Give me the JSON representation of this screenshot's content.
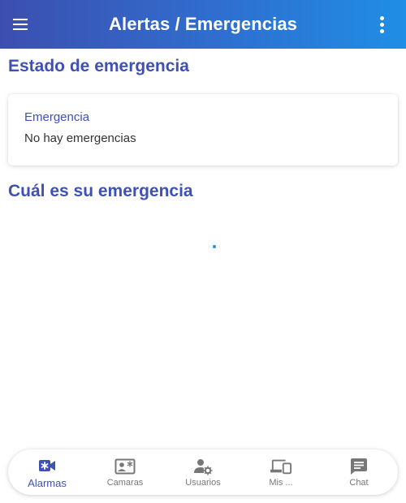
{
  "app_bar": {
    "title": "Alertas / Emergencias",
    "menu_icon": "menu-icon",
    "more_icon": "more-vert-icon"
  },
  "emergency_status": {
    "section_title": "Estado de emergencia",
    "label": "Emergencia",
    "value": "No hay emergencias"
  },
  "question_section": {
    "section_title": "Cuál es su emergencia"
  },
  "bottom_nav": {
    "items": [
      {
        "label": "Alarmas",
        "icon": "video-alarm-icon",
        "active": true
      },
      {
        "label": "Camaras",
        "icon": "camera-card-icon",
        "active": false
      },
      {
        "label": "Usuarios",
        "icon": "user-settings-icon",
        "active": false
      },
      {
        "label": "Mis ...",
        "icon": "devices-icon",
        "active": false
      },
      {
        "label": "Chat",
        "icon": "chat-icon",
        "active": false
      }
    ]
  },
  "colors": {
    "primary": "#3f51b5",
    "accent": "#1f8ee6",
    "inactive": "#777777"
  }
}
